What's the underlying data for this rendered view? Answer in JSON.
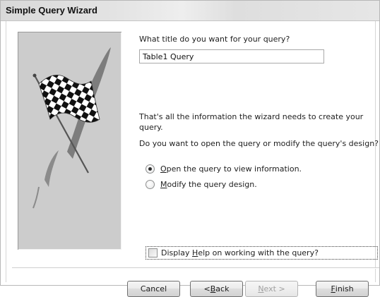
{
  "window": {
    "title": "Simple Query Wizard"
  },
  "form": {
    "title_prompt": "What title do you want for your query?",
    "title_value": "Table1 Query",
    "info_line": "That's all the information the wizard needs to create your query.",
    "question": "Do you want to open the query or modify the query's design?",
    "options": [
      {
        "prefix": "",
        "accel": "O",
        "rest": "pen the query to view information.",
        "selected": true
      },
      {
        "prefix": "",
        "accel": "M",
        "rest": "odify the query design.",
        "selected": false
      }
    ],
    "help_checkbox": {
      "prefix": "Display ",
      "accel": "H",
      "rest": "elp on working with the query?",
      "checked": false
    }
  },
  "buttons": {
    "cancel": {
      "prefix": "Cancel",
      "accel": "",
      "rest": ""
    },
    "back": {
      "prefix": "< ",
      "accel": "B",
      "rest": "ack"
    },
    "next": {
      "prefix": "",
      "accel": "N",
      "rest": "ext >"
    },
    "finish": {
      "prefix": "",
      "accel": "F",
      "rest": "inish"
    }
  },
  "icons": {
    "wizard_picture": "checkered-flag-icon"
  }
}
